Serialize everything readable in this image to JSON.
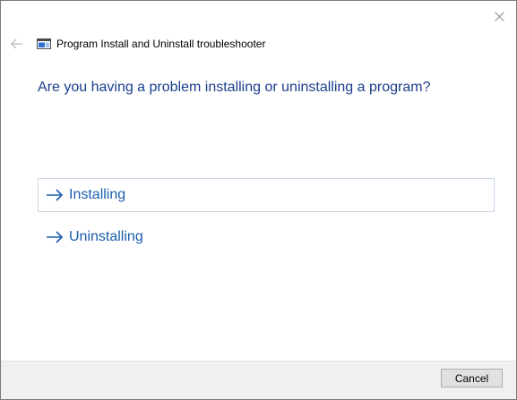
{
  "window": {
    "title": "Program Install and Uninstall troubleshooter",
    "close_icon": "close-icon",
    "back_icon": "back-arrow-icon",
    "app_icon": "troubleshooter-app-icon"
  },
  "main": {
    "question": "Are you having a problem installing or uninstalling a program?",
    "options": [
      {
        "label": "Installing",
        "icon": "right-arrow-icon",
        "highlighted": true
      },
      {
        "label": "Uninstalling",
        "icon": "right-arrow-icon",
        "highlighted": false
      }
    ]
  },
  "footer": {
    "cancel_label": "Cancel"
  },
  "colors": {
    "question_text": "#1a3e8c",
    "option_text": "#1a5dab",
    "option_border": "#c8d6e6",
    "footer_bg": "#f0f0f0"
  }
}
